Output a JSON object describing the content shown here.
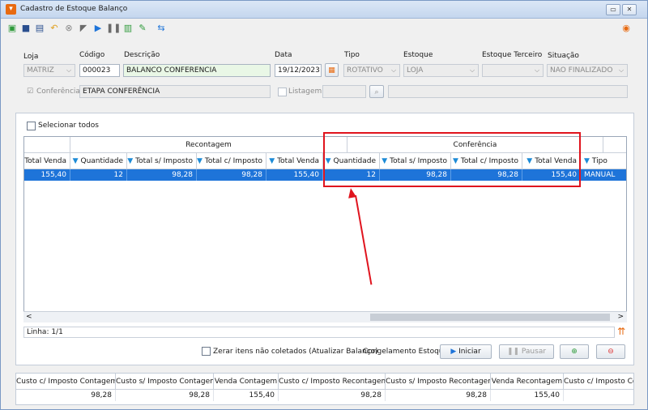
{
  "window": {
    "title": "Cadastro de Estoque Balanço",
    "min_glyph": "▭",
    "close_glyph": "✕"
  },
  "toolbar": {
    "icons": [
      "new-icon",
      "save-icon",
      "save-all-icon",
      "undo-icon",
      "delete-icon",
      "flag-icon",
      "play-icon",
      "pause-icon",
      "stats-icon",
      "edit-icon",
      "refresh-icon"
    ]
  },
  "form": {
    "loja": {
      "label": "Loja",
      "value": "MATRIZ"
    },
    "codigo": {
      "label": "Código",
      "value": "000023"
    },
    "descricao": {
      "label": "Descrição",
      "value": "BALANCO CONFERENCIA"
    },
    "data": {
      "label": "Data",
      "value": "19/12/2023"
    },
    "tipo": {
      "label": "Tipo",
      "value": "ROTATIVO"
    },
    "estoque": {
      "label": "Estoque",
      "value": "LOJA"
    },
    "estoque_terceiro": {
      "label": "Estoque Terceiro",
      "value": ""
    },
    "situacao": {
      "label": "Situação",
      "value": "NAO FINALIZADO"
    },
    "conferencia": {
      "label": "Conferência",
      "value": "ETAPA CONFERÊNCIA"
    },
    "listagem": {
      "label": "Listagem",
      "value": ""
    }
  },
  "grid": {
    "select_all": "Selecionar todos",
    "bands": {
      "recontagem": "Recontagem",
      "conferencia": "Conferência"
    },
    "columns": [
      "Total Venda",
      "Quantidade",
      "Total s/ Imposto",
      "Total c/ Imposto",
      "Total Venda",
      "Quantidade",
      "Total s/ Imposto",
      "Total c/ Imposto",
      "Total Venda",
      "Tipo"
    ],
    "row": [
      "155,40",
      "12",
      "98,28",
      "98,28",
      "155,40",
      "12",
      "98,28",
      "98,28",
      "155,40",
      "MANUAL"
    ],
    "status": "Linha: 1/1",
    "scroll_left": "<",
    "scroll_right": ">"
  },
  "actions": {
    "zerar": "Zerar itens não coletados (Atualizar Balanço)",
    "congelamento": "Congelamento Estoque",
    "iniciar": "Iniciar",
    "pausar": "Pausar"
  },
  "summary": {
    "columns": [
      "Custo c/ Imposto Contagem",
      "Custo s/ Imposto Contagem",
      "Venda Contagem",
      "Custo c/ Imposto Recontagem",
      "Custo s/ Imposto Recontagem",
      "Venda Recontagem",
      "Custo c/ Imposto Con"
    ],
    "values": [
      "98,28",
      "98,28",
      "155,40",
      "98,28",
      "98,28",
      "155,40",
      ""
    ]
  },
  "colors": {
    "accent": "#1e74d9",
    "highlight": "#e0141e",
    "filter": "#1d8bd6"
  }
}
